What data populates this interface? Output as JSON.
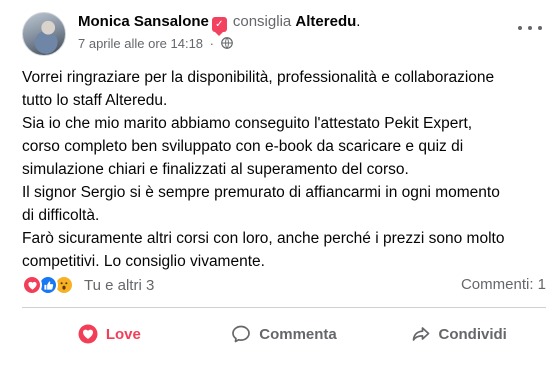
{
  "post": {
    "author": "Monica Sansalone",
    "action": "consiglia",
    "page": "Alteredu",
    "page_suffix": ".",
    "timestamp": "7 aprile alle ore 14:18",
    "separator": "·",
    "privacy_icon": "globe-icon",
    "lines": [
      "Vorrei ringraziare per la disponibilità, professionalità e collaborazione",
      "tutto lo staff Alteredu.",
      "Sia io che mio marito abbiamo conseguito l'attestato Pekit Expert,",
      "corso completo ben sviluppato con e-book da scaricare e quiz di",
      "simulazione chiari e finalizzati al superamento del corso.",
      "Il signor Sergio si è sempre premurato di affiancarmi in ogni momento",
      "di difficoltà.",
      "Farò sicuramente altri corsi con loro, anche perché i prezzi sono molto",
      "competitivi. Lo consiglio vivamente."
    ]
  },
  "stats": {
    "reactions": [
      "love-icon",
      "like-icon",
      "wow-icon"
    ],
    "reactors": "Tu e altri 3",
    "comments": "Commenti: 1"
  },
  "actions": {
    "love": "Love",
    "comment": "Commenta",
    "share": "Condividi"
  },
  "colors": {
    "love": "#f33e58",
    "like": "#1877f2",
    "wow": "#f7b125",
    "secondary_text": "#65676b",
    "badge": "#f3425f"
  }
}
